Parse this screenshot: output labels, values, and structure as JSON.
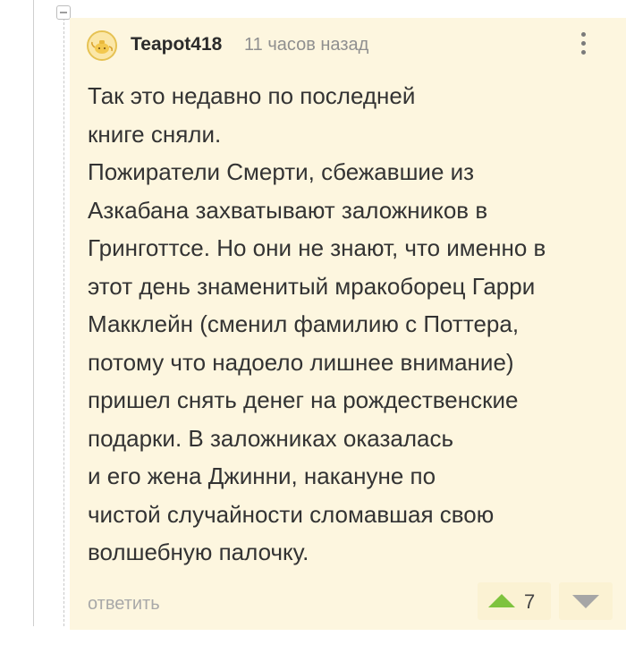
{
  "comment": {
    "author": "Teapot418",
    "time": "11 часов назад",
    "avatar_icon": "teapot-avatar-icon",
    "body_lines": [
      "Так это недавно по последней",
      "книге сняли.",
      "Пожиратели Смерти, сбежавшие из",
      "Азкабана захватывают заложников в",
      "Гринготтсе. Но они не знают, что именно в",
      "этот день знаменитый мракоборец Гарри",
      "Макклейн (сменил фамилию с Поттера,",
      "потому что надоело лишнее внимание)",
      "пришел снять денег на рождественские",
      "подарки. В заложниках оказалась",
      "и его жена Джинни, накануне по",
      "чистой случайности сломавшая свою",
      "волшебную палочку."
    ],
    "reply_label": "ответить",
    "rating": "7"
  },
  "colors": {
    "comment_background": "#fdf6df",
    "upvote": "#7ec33e",
    "downvote": "#a6a6a6",
    "avatar_border": "#e6c253"
  }
}
